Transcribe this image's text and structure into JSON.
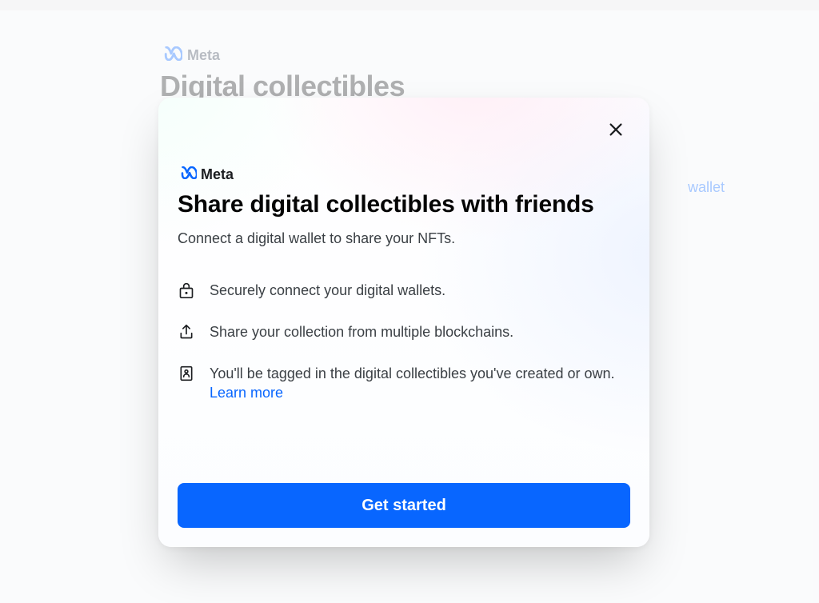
{
  "background": {
    "meta_label": "Meta",
    "page_title": "Digital collectibles",
    "connect_wallet_link": "wallet"
  },
  "modal": {
    "meta_label": "Meta",
    "title": "Share digital collectibles with friends",
    "subtitle": "Connect a digital wallet to share your NFTs.",
    "features": [
      {
        "icon": "lock-icon",
        "text": "Securely connect your digital wallets."
      },
      {
        "icon": "share-icon",
        "text": "Share your collection from multiple blockchains."
      },
      {
        "icon": "tag-icon",
        "text": "You'll be tagged in the digital collectibles you've created or own. ",
        "link_text": "Learn more"
      }
    ],
    "cta_label": "Get started"
  },
  "colors": {
    "primary": "#0866ff",
    "text": "#1c1e21",
    "muted": "#3b4045"
  }
}
